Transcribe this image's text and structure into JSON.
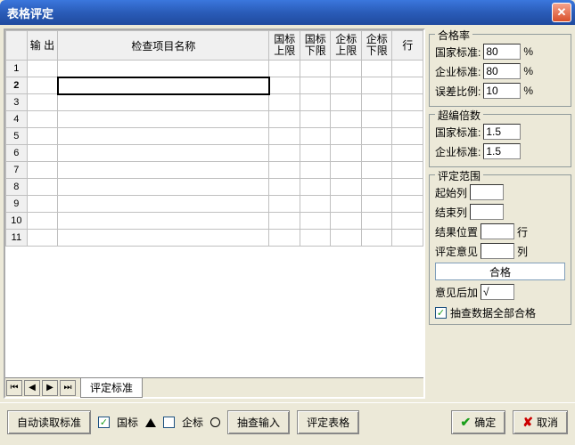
{
  "title": "表格评定",
  "table": {
    "headers": {
      "output": "输\n出",
      "name": "检查项目名称",
      "gb_up": "国标\n上限",
      "gb_low": "国标\n下限",
      "ent_up": "企标\n上限",
      "ent_low": "企标\n下限",
      "row": "行"
    },
    "row_count": 11,
    "selected_row": 2
  },
  "sheet_tab": "评定标准",
  "pass_rate": {
    "title": "合格率",
    "national_label": "国家标准:",
    "national_value": "80",
    "enterprise_label": "企业标准:",
    "enterprise_value": "80",
    "error_label": "误差比例:",
    "error_value": "10",
    "percent": "%"
  },
  "multiple": {
    "title": "超编倍数",
    "national_label": "国家标准:",
    "national_value": "1.5",
    "enterprise_label": "企业标准:",
    "enterprise_value": "1.5"
  },
  "range": {
    "title": "评定范围",
    "start_col": "起始列",
    "start_col_value": "",
    "end_col": "结束列",
    "end_col_value": "",
    "result_pos": "结果位置",
    "result_pos_value": "",
    "row_suffix": "行",
    "opinion": "评定意见",
    "opinion_value": "",
    "col_suffix": "列",
    "qualified": "合格",
    "append_label": "意见后加",
    "append_value": "√",
    "checkbox_label": "抽查数据全部合格",
    "checkbox_checked": true
  },
  "bottom": {
    "auto_read": "自动读取标准",
    "gb": "国标",
    "ent": "企标",
    "check_input": "抽查输入",
    "eval_table": "评定表格",
    "ok": "确定",
    "cancel": "取消"
  }
}
